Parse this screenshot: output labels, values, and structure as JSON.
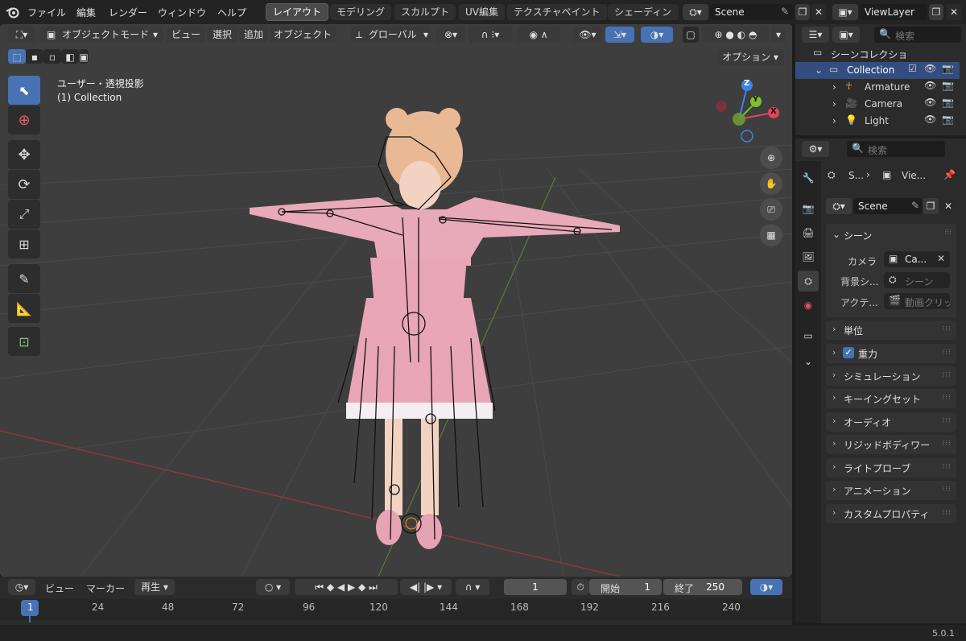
{
  "menu": {
    "items": [
      "ファイル",
      "編集",
      "レンダー",
      "ウィンドウ",
      "ヘルプ"
    ]
  },
  "workspaces": {
    "tabs": [
      "レイアウト",
      "モデリング",
      "スカルプト",
      "UV編集",
      "テクスチャペイント",
      "シェーディン"
    ],
    "active": "レイアウト"
  },
  "scene_selector": {
    "value": "Scene"
  },
  "viewlayer_selector": {
    "value": "ViewLayer"
  },
  "viewport_header": {
    "mode": "オブジェクトモード",
    "menus": [
      "ビュー",
      "選択",
      "追加",
      "オブジェクト"
    ],
    "transform_orientation": "グローバル",
    "options_label": "オプション"
  },
  "viewport": {
    "view_name": "ユーザー・透視投影",
    "collection_label": "(1) Collection",
    "gizmo": {
      "z": "Z",
      "y": "Y",
      "x": "X"
    }
  },
  "timeline": {
    "menus": [
      "ビュー",
      "マーカー"
    ],
    "playback": "再生",
    "current_frame": "1",
    "start_label": "開始",
    "start_value": "1",
    "end_label": "終了",
    "end_value": "250",
    "ruler": [
      "1",
      "24",
      "48",
      "72",
      "96",
      "120",
      "144",
      "168",
      "192",
      "216",
      "240"
    ]
  },
  "outliner": {
    "search_placeholder": "検索",
    "root": "シーンコレクショ",
    "collection": "Collection",
    "items": [
      "Armature",
      "Camera",
      "Light"
    ]
  },
  "properties": {
    "search_placeholder": "検索",
    "breadcrumb": [
      "S...",
      "Vie..."
    ],
    "scene_name": "Scene",
    "section_title": "シーン",
    "rows": [
      {
        "label": "カメラ",
        "value": "Ca..."
      },
      {
        "label": "背景シ...",
        "value": "シーン"
      },
      {
        "label": "アクテ...",
        "value": "動画クリッ"
      }
    ],
    "panels": [
      "単位",
      "重力",
      "シミュレーション",
      "キーイングセット",
      "オーディオ",
      "リジッドボディワー",
      "ライトプローブ",
      "アニメーション",
      "カスタムプロパティ"
    ]
  },
  "status": {
    "version": "5.0.1"
  },
  "colors": {
    "accent": "#4772b3",
    "x_axis": "#e0455a",
    "y_axis": "#7fbf33",
    "z_axis": "#3a83e8",
    "viewport_bg": "#3e3e3e"
  }
}
